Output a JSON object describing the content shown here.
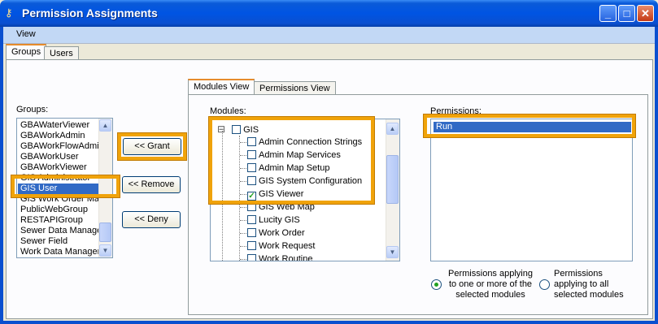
{
  "window": {
    "title": "Permission Assignments",
    "minimize_glyph": "_",
    "maximize_glyph": "□",
    "close_glyph": "✕",
    "app_icon_glyph": "⚷"
  },
  "menu": {
    "view": "View"
  },
  "outer_tabs": {
    "groups": "Groups",
    "users": "Users"
  },
  "groups": {
    "label": "Groups:",
    "items": [
      "GBAWaterViewer",
      "GBAWorkAdmin",
      "GBAWorkFlowAdmin",
      "GBAWorkUser",
      "GBAWorkViewer",
      "GIS Administrator",
      "GIS User",
      "GIS Work Order Mar",
      "PublicWebGroup",
      "RESTAPIGroup",
      "Sewer Data Manage",
      "Sewer Field",
      "Work Data Manager"
    ],
    "selected": "GIS User"
  },
  "buttons": {
    "grant": "<< Grant",
    "remove": "<< Remove",
    "deny": "<< Deny"
  },
  "inner_tabs": {
    "modules_view": "Modules View",
    "permissions_view": "Permissions View"
  },
  "modules": {
    "label": "Modules:",
    "expand_glyph": "⊟",
    "root": "GIS",
    "items": [
      {
        "label": "Admin Connection Strings",
        "checked": false
      },
      {
        "label": "Admin Map Services",
        "checked": false
      },
      {
        "label": "Admin Map Setup",
        "checked": false
      },
      {
        "label": "GIS System Configuration",
        "checked": false
      },
      {
        "label": "GIS Viewer",
        "checked": true
      },
      {
        "label": "GIS Web Map",
        "checked": false
      },
      {
        "label": "Lucity GIS",
        "checked": false
      },
      {
        "label": "Work Order",
        "checked": false
      },
      {
        "label": "Work Request",
        "checked": false
      },
      {
        "label": "Work Routine",
        "checked": false
      }
    ]
  },
  "permissions": {
    "label": "Permissions:",
    "items": [
      "Run"
    ]
  },
  "radios": {
    "one_or_more": "Permissions applying to one or more of the selected modules",
    "all_selected": "Permissions applying to all selected modules",
    "selected": "one_or_more"
  },
  "colors": {
    "highlight": "#f0a30a",
    "selection": "#316ac5",
    "title_bar": "#0054e3"
  }
}
